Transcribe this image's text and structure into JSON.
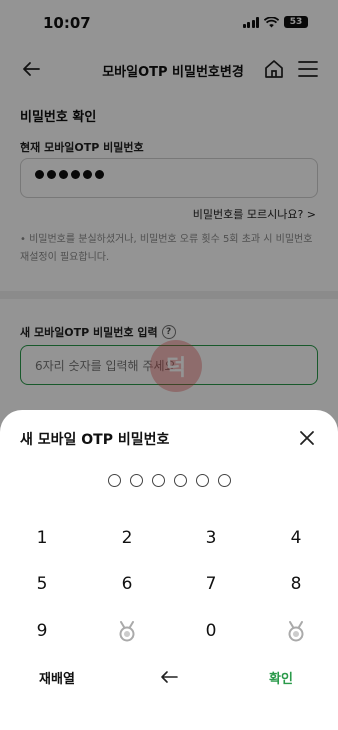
{
  "status_bar": {
    "time": "10:07",
    "battery": "53"
  },
  "header": {
    "title": "모바일OTP 비밀번호변경"
  },
  "current_section": {
    "title": "비밀번호 확인",
    "field_label": "현재 모바일OTP 비밀번호",
    "filled_digits": 6,
    "forgot_link": "비밀번호를 모르시나요? >",
    "notice": "• 비밀번호를 분실하셨거나, 비밀번호 오류 횟수 5회 초과 시 비밀번호 재설정이 필요합니다."
  },
  "new_section": {
    "field_label": "새 모바일OTP 비밀번호 입력",
    "placeholder": "6자리 숫자를 입력해 주세요"
  },
  "sheet": {
    "title": "새 모바일 OTP 비밀번호",
    "pin_length": 6,
    "keys": {
      "row1": [
        "1",
        "2",
        "3",
        "4"
      ],
      "row2": [
        "5",
        "6",
        "7",
        "8"
      ],
      "row3": [
        "9",
        "0"
      ],
      "rearrange": "재배열",
      "confirm": "확인"
    }
  },
  "colors": {
    "accent": "#2a9a4a",
    "overlay": "rgba(0,0,0,0.42)"
  }
}
